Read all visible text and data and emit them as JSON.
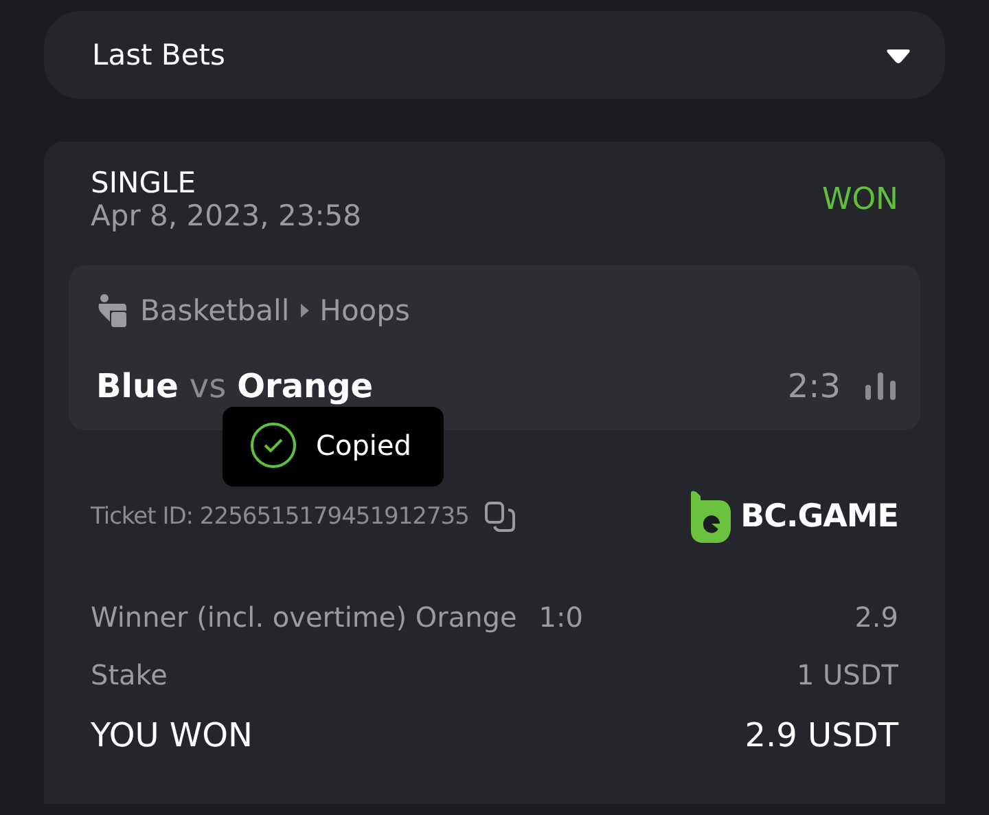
{
  "header": {
    "title": "Last Bets",
    "expanded": false
  },
  "bet": {
    "type": "SINGLE",
    "date": "Apr 8, 2023, 23:58",
    "status": "WON",
    "kind": "won",
    "event": {
      "sport": "Basketball",
      "league": "Hoops",
      "home": "Blue",
      "vs": "vs",
      "away": "Orange",
      "score": "2:3"
    },
    "toast": "Copied",
    "ticket": {
      "label": "Ticket ID:",
      "id": "2256515179451912735"
    },
    "brand": "BC.GAME",
    "details": [
      {
        "kind": "pick",
        "label": "Winner (incl. overtime) Orange",
        "extra": "1:0",
        "value": "2.9"
      },
      {
        "kind": "stake",
        "label": "Stake",
        "value": "1 USDT"
      },
      {
        "kind": "total",
        "label": "YOU WON",
        "value": "2.9 USDT"
      }
    ]
  }
}
